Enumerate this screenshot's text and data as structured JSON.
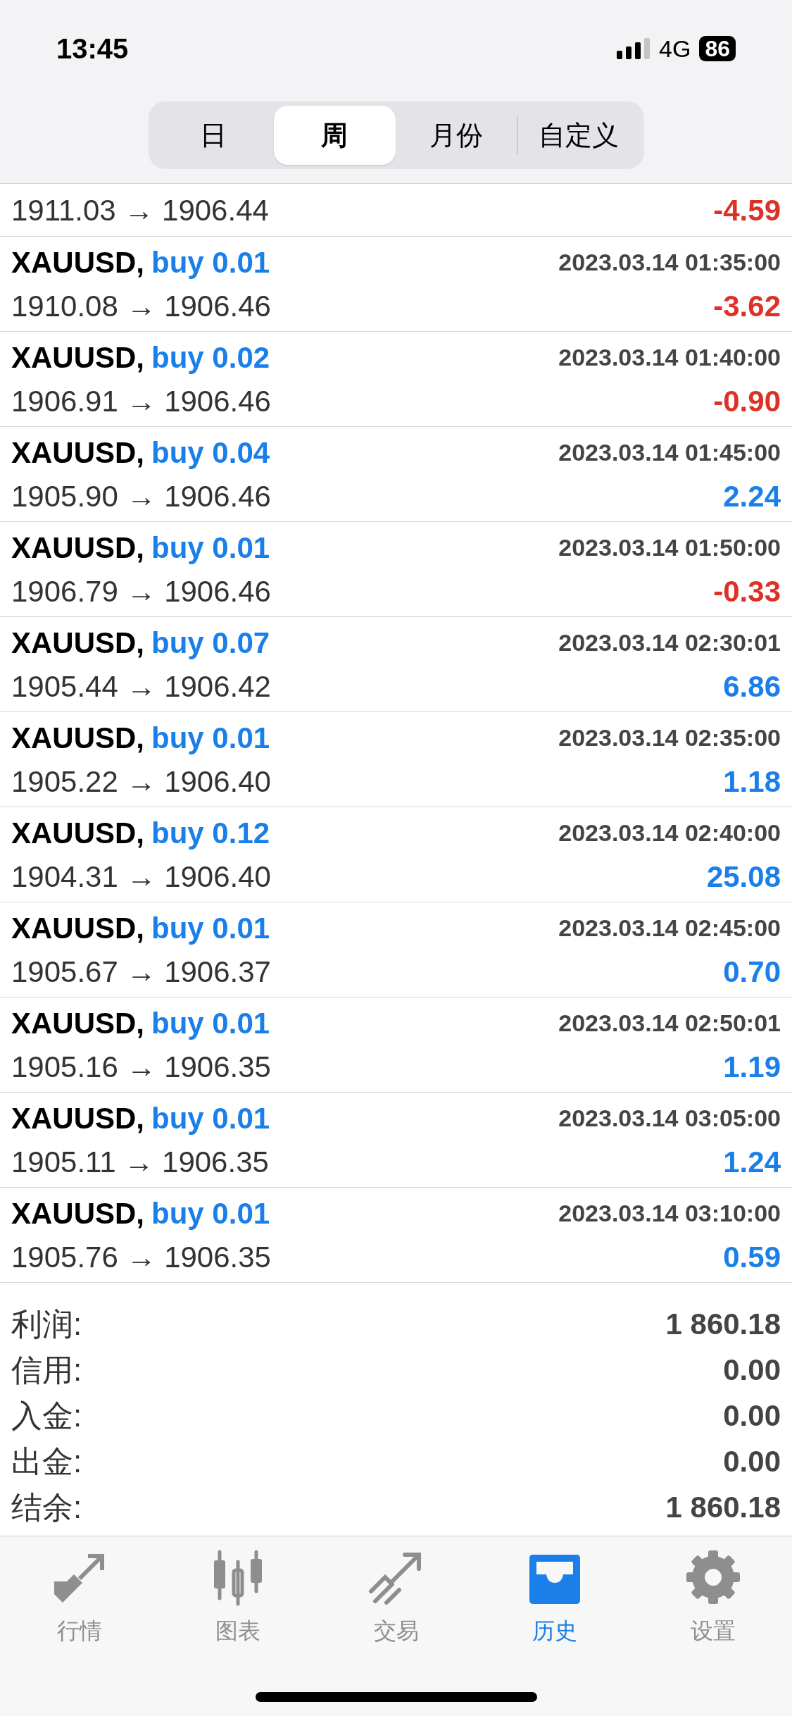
{
  "status_bar": {
    "time": "13:45",
    "network": "4G",
    "battery": "86"
  },
  "segments": [
    {
      "label": "日",
      "selected": false
    },
    {
      "label": "周",
      "selected": true
    },
    {
      "label": "月份",
      "selected": false
    },
    {
      "label": "自定义",
      "selected": false
    }
  ],
  "deals": [
    {
      "prices": "1911.03 → 1906.44",
      "profit": "-4.59",
      "loss": true
    },
    {
      "symbol": "XAUUSD,",
      "order": "buy 0.01",
      "time": "2023.03.14 01:35:00",
      "prices": "1910.08 → 1906.46",
      "profit": "-3.62",
      "loss": true
    },
    {
      "symbol": "XAUUSD,",
      "order": "buy 0.02",
      "time": "2023.03.14 01:40:00",
      "prices": "1906.91 → 1906.46",
      "profit": "-0.90",
      "loss": true
    },
    {
      "symbol": "XAUUSD,",
      "order": "buy 0.04",
      "time": "2023.03.14 01:45:00",
      "prices": "1905.90 → 1906.46",
      "profit": "2.24",
      "loss": false
    },
    {
      "symbol": "XAUUSD,",
      "order": "buy 0.01",
      "time": "2023.03.14 01:50:00",
      "prices": "1906.79 → 1906.46",
      "profit": "-0.33",
      "loss": true
    },
    {
      "symbol": "XAUUSD,",
      "order": "buy 0.07",
      "time": "2023.03.14 02:30:01",
      "prices": "1905.44 → 1906.42",
      "profit": "6.86",
      "loss": false
    },
    {
      "symbol": "XAUUSD,",
      "order": "buy 0.01",
      "time": "2023.03.14 02:35:00",
      "prices": "1905.22 → 1906.40",
      "profit": "1.18",
      "loss": false
    },
    {
      "symbol": "XAUUSD,",
      "order": "buy 0.12",
      "time": "2023.03.14 02:40:00",
      "prices": "1904.31 → 1906.40",
      "profit": "25.08",
      "loss": false
    },
    {
      "symbol": "XAUUSD,",
      "order": "buy 0.01",
      "time": "2023.03.14 02:45:00",
      "prices": "1905.67 → 1906.37",
      "profit": "0.70",
      "loss": false
    },
    {
      "symbol": "XAUUSD,",
      "order": "buy 0.01",
      "time": "2023.03.14 02:50:01",
      "prices": "1905.16 → 1906.35",
      "profit": "1.19",
      "loss": false
    },
    {
      "symbol": "XAUUSD,",
      "order": "buy 0.01",
      "time": "2023.03.14 03:05:00",
      "prices": "1905.11 → 1906.35",
      "profit": "1.24",
      "loss": false
    },
    {
      "symbol": "XAUUSD,",
      "order": "buy 0.01",
      "time": "2023.03.14 03:10:00",
      "prices": "1905.76 → 1906.35",
      "profit": "0.59",
      "loss": false
    }
  ],
  "summary": [
    {
      "label": "利润:",
      "value": "1 860.18"
    },
    {
      "label": "信用:",
      "value": "0.00"
    },
    {
      "label": "入金:",
      "value": "0.00"
    },
    {
      "label": "出金:",
      "value": "0.00"
    },
    {
      "label": "结余:",
      "value": "1 860.18"
    }
  ],
  "tab_bar": [
    {
      "label": "行情",
      "selected": false
    },
    {
      "label": "图表",
      "selected": false
    },
    {
      "label": "交易",
      "selected": false
    },
    {
      "label": "历史",
      "selected": true
    },
    {
      "label": "设置",
      "selected": false
    }
  ]
}
